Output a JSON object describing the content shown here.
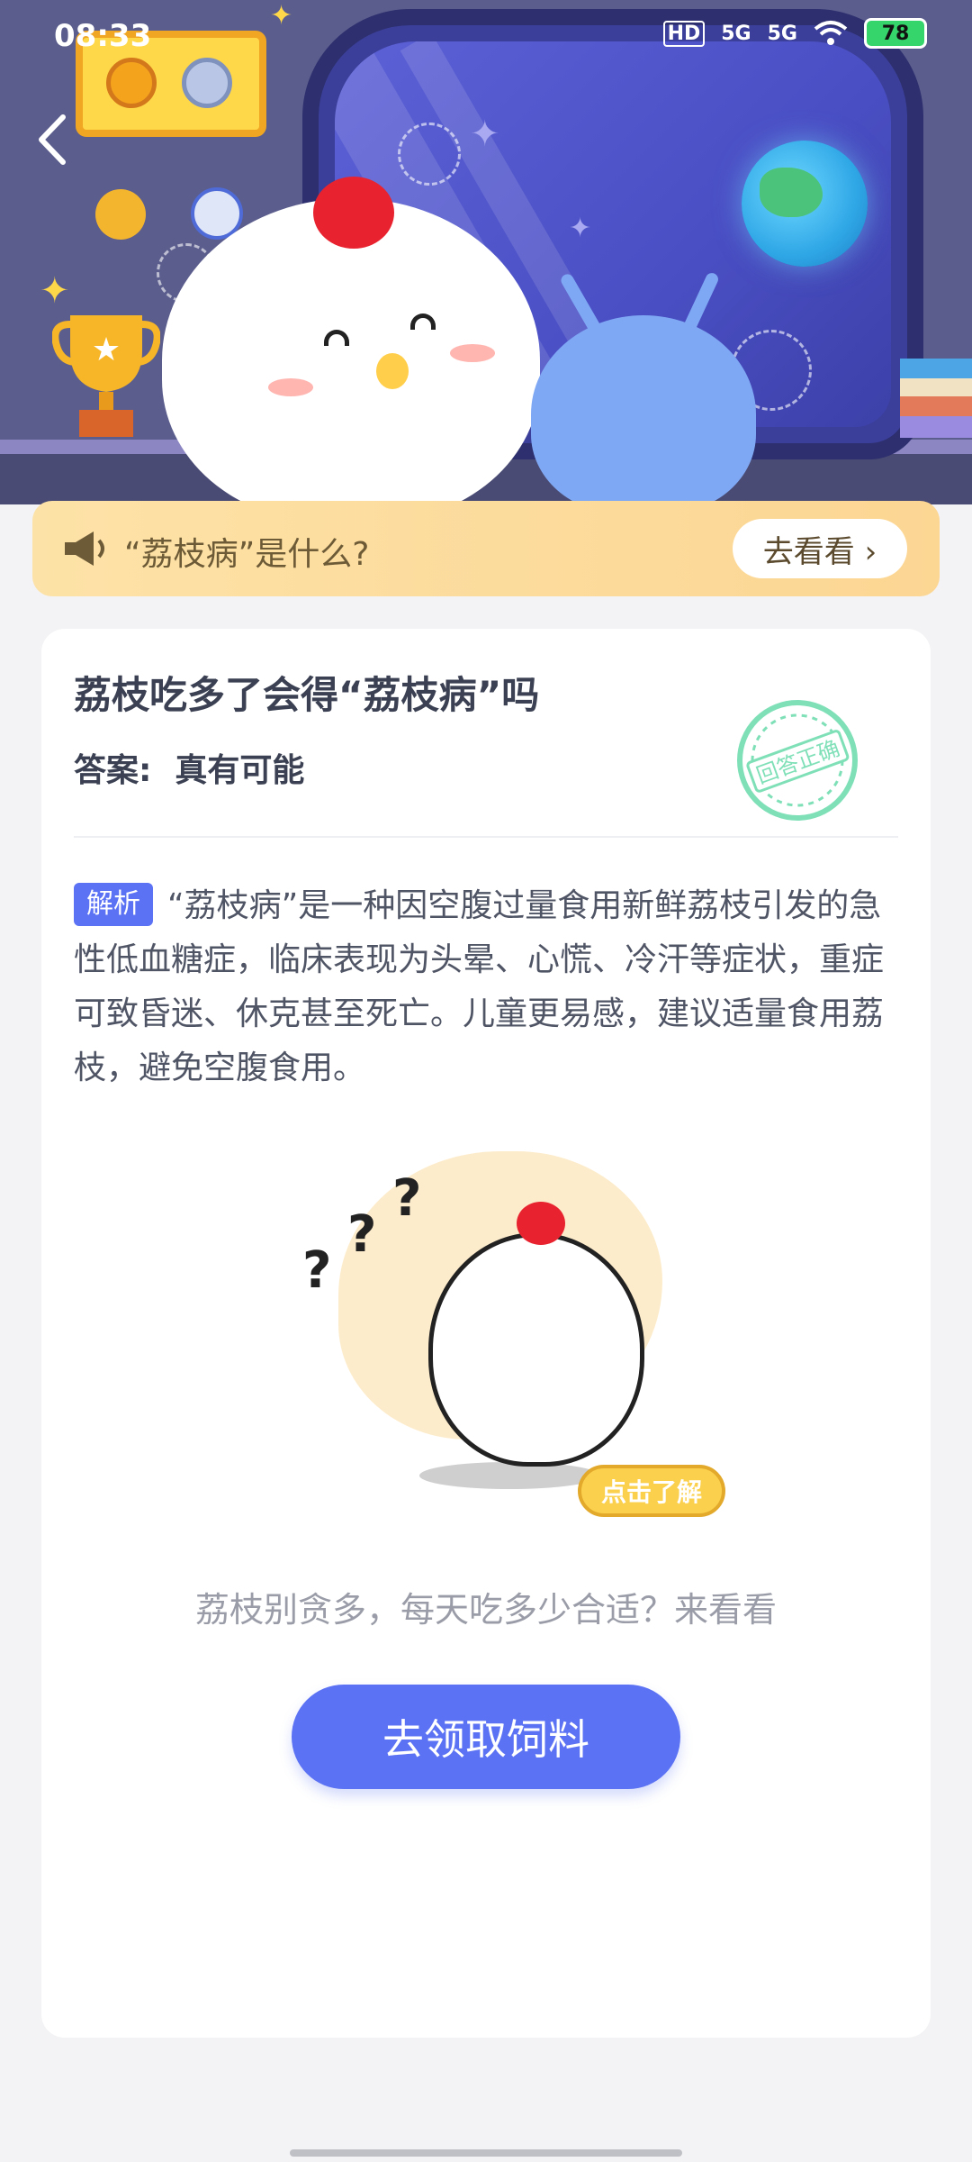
{
  "status_bar": {
    "time": "08:33",
    "network_badge": "HD",
    "signal_1": "5G",
    "signal_2": "5G",
    "battery": "78"
  },
  "notice": {
    "text": "“荔枝病”是什么?",
    "button_label": "去看看 ›"
  },
  "question": {
    "title": "荔枝吃多了会得“荔枝病”吗",
    "answer_label": "答案:",
    "answer_value": "真有可能",
    "stamp_text": "回答正确"
  },
  "analysis": {
    "tag": "解析",
    "text": "“荔枝病”是一种因空腹过量食用新鲜荔枝引发的急性低血糖症，临床表现为头晕、心慌、冷汗等症状，重症可致昏迷、休克甚至死亡。儿童更易感，建议适量食用荔枝，避免空腹食用。"
  },
  "illustration": {
    "button_label": "点击了解"
  },
  "tip": "荔枝别贪多，每天吃多少合适？来看看",
  "cta_label": "去领取饲料",
  "colors": {
    "accent": "#5b72f4",
    "banner": "#fcd693",
    "hero_bg": "#5b5d8d"
  }
}
